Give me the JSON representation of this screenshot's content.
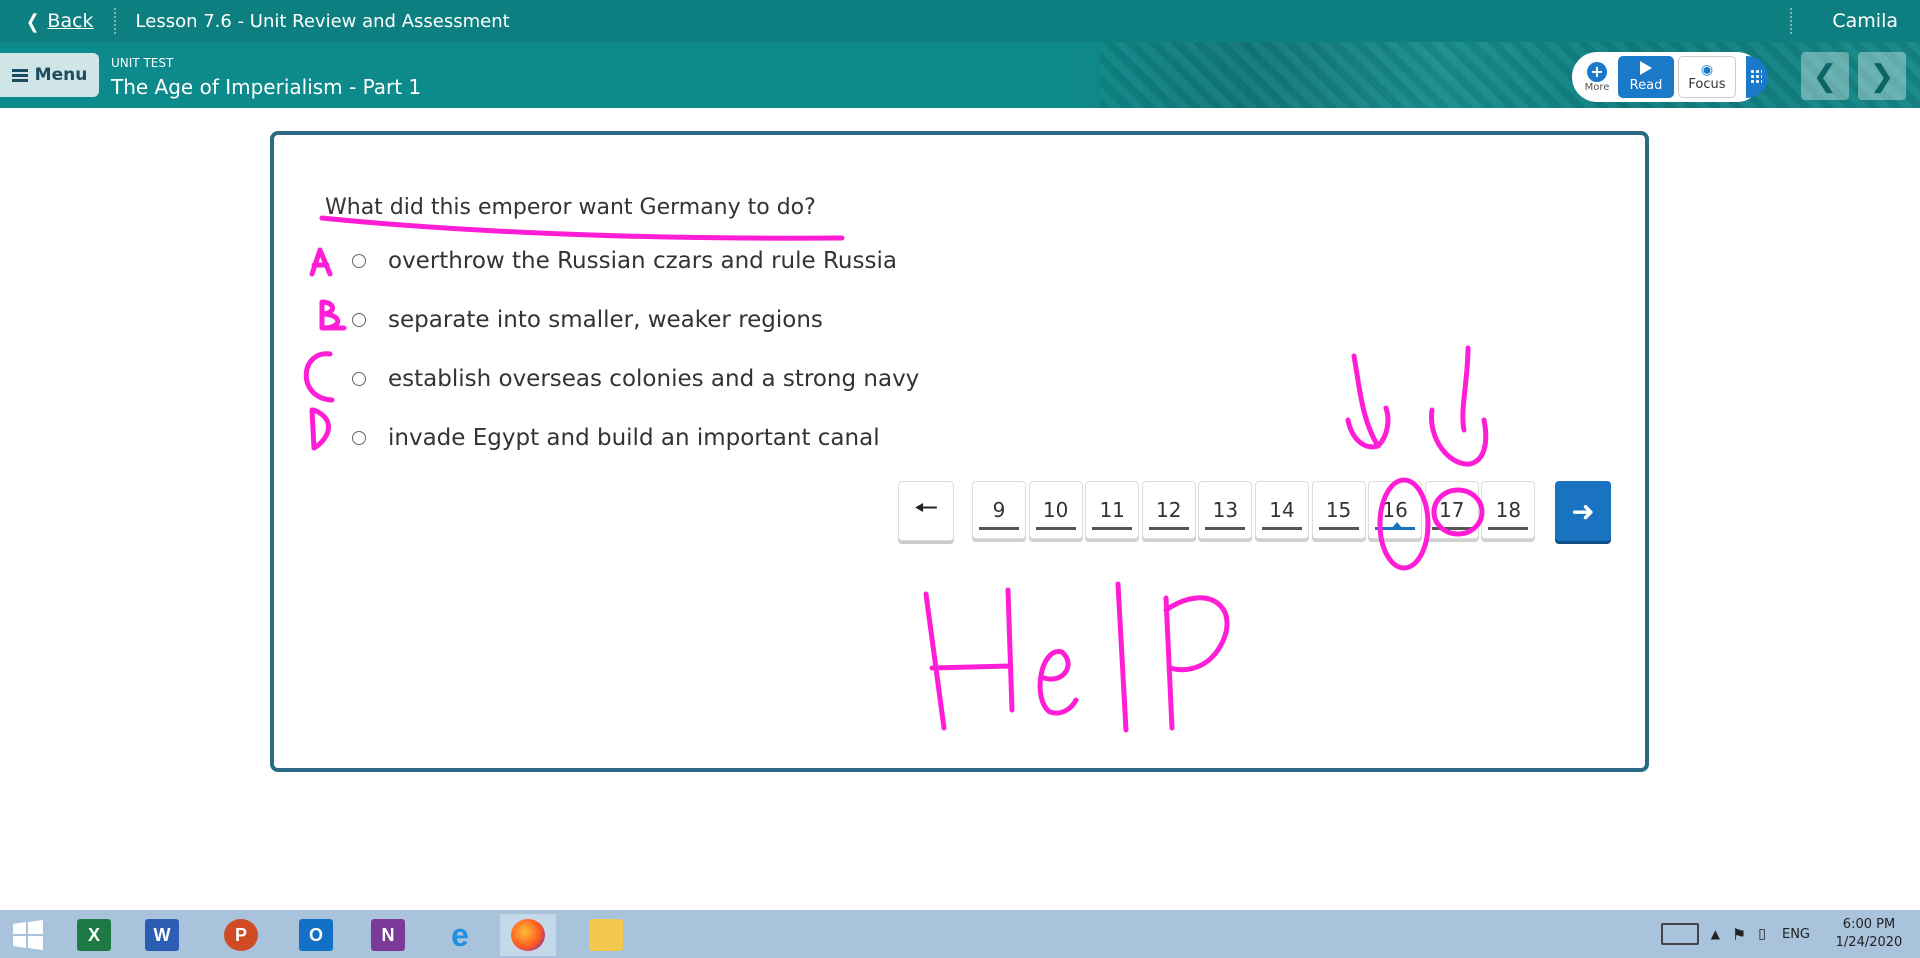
{
  "topbar": {
    "back_label": "Back",
    "lesson_title": "Lesson 7.6 - Unit Review and Assessment",
    "user_name": "Camila"
  },
  "subbar": {
    "menu_label": "Menu",
    "unit_label": "UNIT TEST",
    "unit_title": "The Age of Imperialism - Part 1",
    "tools": {
      "more_label": "More",
      "read_label": "Read",
      "focus_label": "Focus"
    }
  },
  "question": {
    "text": "What did this emperor want Germany to do?",
    "choices": [
      "overthrow the Russian czars and rule Russia",
      "separate into smaller, weaker regions",
      "establish overseas colonies and a strong navy",
      "invade Egypt and build an important canal"
    ]
  },
  "pager": {
    "pages": [
      "9",
      "10",
      "11",
      "12",
      "13",
      "14",
      "15",
      "16",
      "17",
      "18"
    ],
    "current": "16"
  },
  "annotations": {
    "color": "#ff1ed6",
    "letters": [
      "A",
      "B",
      "C",
      "D"
    ],
    "help_text": "HelP"
  },
  "taskbar": {
    "apps": [
      "windows-start-icon",
      "excel-icon",
      "word-icon",
      "powerpoint-icon",
      "outlook-icon",
      "onenote-icon",
      "internet-explorer-icon",
      "firefox-icon",
      "file-explorer-icon"
    ],
    "language": "ENG",
    "time": "6:00 PM",
    "date": "1/24/2020"
  },
  "colors": {
    "topbar": "#0e7f80",
    "accent_blue": "#1a73c0",
    "card_border": "#2a6a84"
  }
}
